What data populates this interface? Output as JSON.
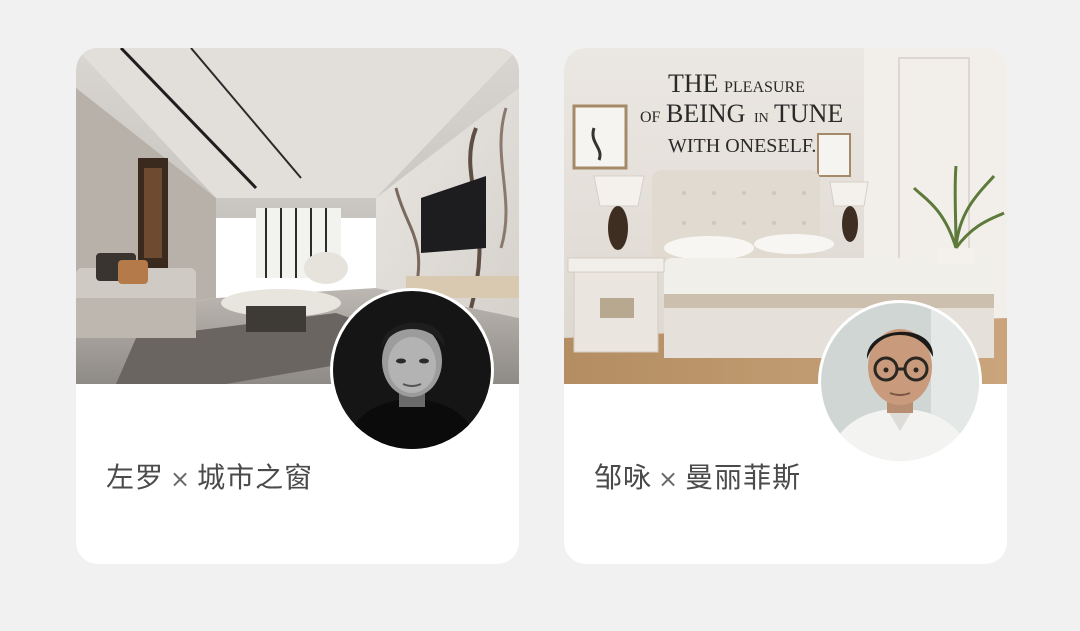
{
  "cards": [
    {
      "photo": "modern-living-room-photo",
      "designer": "左罗",
      "separator": "×",
      "project": "城市之窗"
    },
    {
      "photo": "bedroom-mattress-photo",
      "designer": "邹咏",
      "separator": "×",
      "project": "曼丽菲斯",
      "wall_text": {
        "line1a": "THE",
        "line1b": "PLEASURE",
        "line2a": "OF",
        "line2b": "BEING",
        "line2c": "IN",
        "line2d": "TUNE",
        "line3": "WITH ONESELF."
      }
    }
  ],
  "avatars": [
    {
      "icon": "person-portrait-bw"
    },
    {
      "icon": "person-portrait-glasses"
    }
  ]
}
